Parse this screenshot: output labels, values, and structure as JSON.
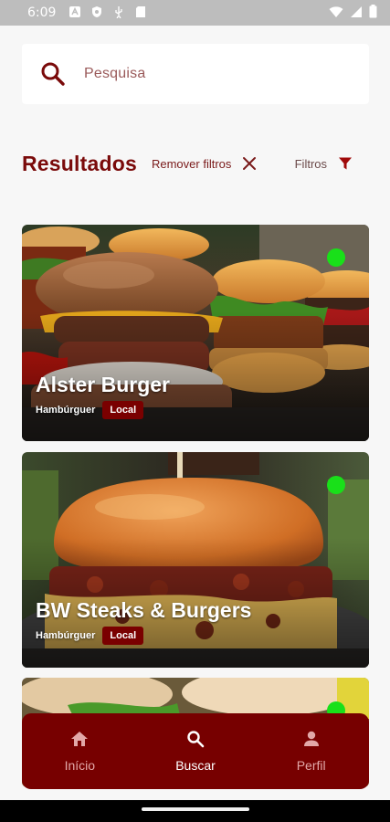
{
  "status_bar": {
    "time": "6:09",
    "left_icons": [
      "a-notification-icon",
      "shield-icon",
      "usb-icon",
      "sd-card-icon"
    ],
    "right_icons": [
      "wifi-icon",
      "signal-icon",
      "battery-icon"
    ]
  },
  "search": {
    "placeholder": "Pesquisa",
    "icon": "search-icon"
  },
  "results_header": {
    "title": "Resultados",
    "remove_filters_label": "Remover filtros",
    "filters_label": "Filtros"
  },
  "restaurants": [
    {
      "name": "Alster Burger",
      "category": "Hambúrguer",
      "tag": "Local",
      "online": true
    },
    {
      "name": "BW Steaks & Burgers",
      "category": "Hambúrguer",
      "tag": "Local",
      "online": true
    },
    {
      "name": "",
      "category": "",
      "tag": "",
      "online": true
    }
  ],
  "bottom_nav": {
    "items": [
      {
        "label": "Início",
        "icon": "home-icon",
        "active": false
      },
      {
        "label": "Buscar",
        "icon": "search-icon",
        "active": true
      },
      {
        "label": "Perfil",
        "icon": "person-icon",
        "active": false
      }
    ]
  },
  "colors": {
    "brand": "#770000",
    "title": "#7a0a0a",
    "online_dot": "#19e019",
    "status_bar": "#bdbdbd"
  }
}
